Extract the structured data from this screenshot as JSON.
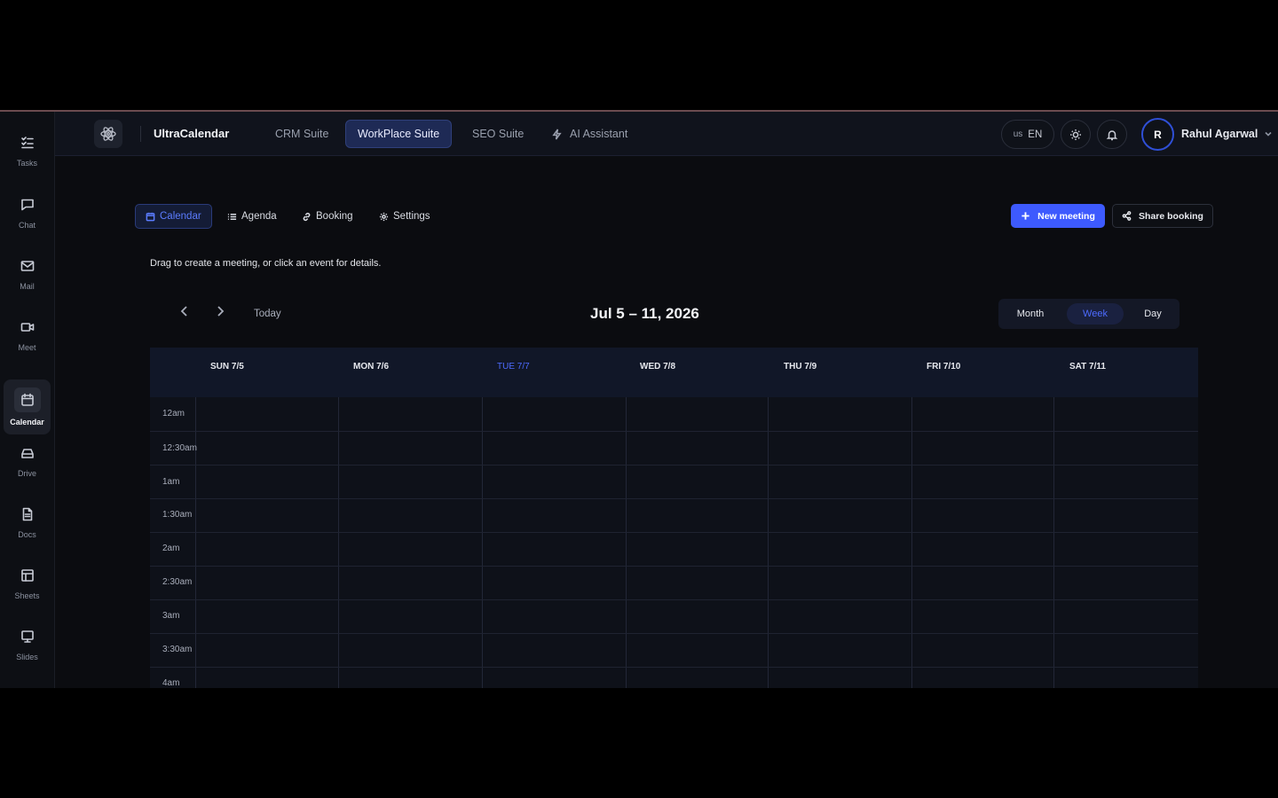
{
  "sidebar": {
    "items": [
      {
        "label": "Tasks",
        "icon": "tasks-icon"
      },
      {
        "label": "Chat",
        "icon": "chat-icon"
      },
      {
        "label": "Mail",
        "icon": "mail-icon"
      },
      {
        "label": "Meet",
        "icon": "video-icon"
      },
      {
        "label": "Calendar",
        "icon": "calendar-icon",
        "active": true
      },
      {
        "label": "Drive",
        "icon": "drive-icon"
      },
      {
        "label": "Docs",
        "icon": "docs-icon"
      },
      {
        "label": "Sheets",
        "icon": "sheets-icon"
      },
      {
        "label": "Slides",
        "icon": "slides-icon"
      }
    ]
  },
  "topbar": {
    "app_title": "UltraCalendar",
    "nav": [
      "CRM Suite",
      "WorkPlace Suite",
      "SEO Suite",
      "AI Assistant"
    ],
    "active_nav": "WorkPlace Suite",
    "lang_region": "us",
    "lang_code": "EN",
    "user_initial": "R",
    "user_name": "Rahul Agarwal"
  },
  "subnav": {
    "tabs": [
      "Calendar",
      "Agenda",
      "Booking",
      "Settings"
    ],
    "active_tab": "Calendar",
    "new_meeting": "New meeting",
    "share_booking": "Share booking"
  },
  "hint": "Drag to create a meeting, or click an event for details.",
  "toolbar": {
    "today": "Today",
    "range": "Jul 5 – 11, 2026",
    "views": [
      "Month",
      "Week",
      "Day"
    ],
    "active_view": "Week"
  },
  "grid": {
    "days": [
      "SUN 7/5",
      "MON 7/6",
      "TUE 7/7",
      "WED 7/8",
      "THU 7/9",
      "FRI 7/10",
      "SAT 7/11"
    ],
    "today_day": "TUE 7/7",
    "times": [
      "12am",
      "12:30am",
      "1am",
      "1:30am",
      "2am",
      "2:30am",
      "3am",
      "3:30am",
      "4am"
    ]
  },
  "colors": {
    "accent": "#3d5afe",
    "today": "#4d6bff",
    "background": "#0b0c10"
  }
}
